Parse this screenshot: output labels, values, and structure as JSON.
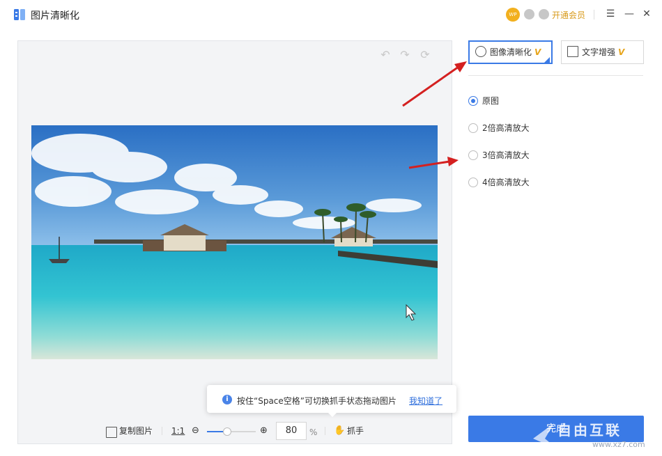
{
  "app": {
    "title": "图片清晰化"
  },
  "header": {
    "wp_badge": "WP",
    "vip_label": "开通会员"
  },
  "canvas": {
    "tooltip": {
      "text": "按住“Space空格”可切换抓手状态拖动图片",
      "link": "我知道了"
    },
    "toolbar": {
      "copy_label": "复制图片",
      "ratio_label": "1:1",
      "zoom_value": "80",
      "zoom_unit": "%",
      "zoom_level": 0.4,
      "hand_label": "抓手"
    }
  },
  "tabs": [
    {
      "label": "图像清晰化",
      "badge": "V",
      "active": true
    },
    {
      "label": "文字增强",
      "badge": "V",
      "active": false
    }
  ],
  "options": [
    {
      "label": "原图",
      "selected": true
    },
    {
      "label": "2倍高清放大",
      "selected": false
    },
    {
      "label": "3倍高清放大",
      "selected": false
    },
    {
      "label": "4倍高清放大",
      "selected": false
    }
  ],
  "done_label": "完成",
  "watermark": {
    "text": "自由互联",
    "url": "www.xz7.com"
  },
  "colors": {
    "accent": "#3a7ae6",
    "vip": "#d89a1a",
    "arrow": "#d42020"
  }
}
